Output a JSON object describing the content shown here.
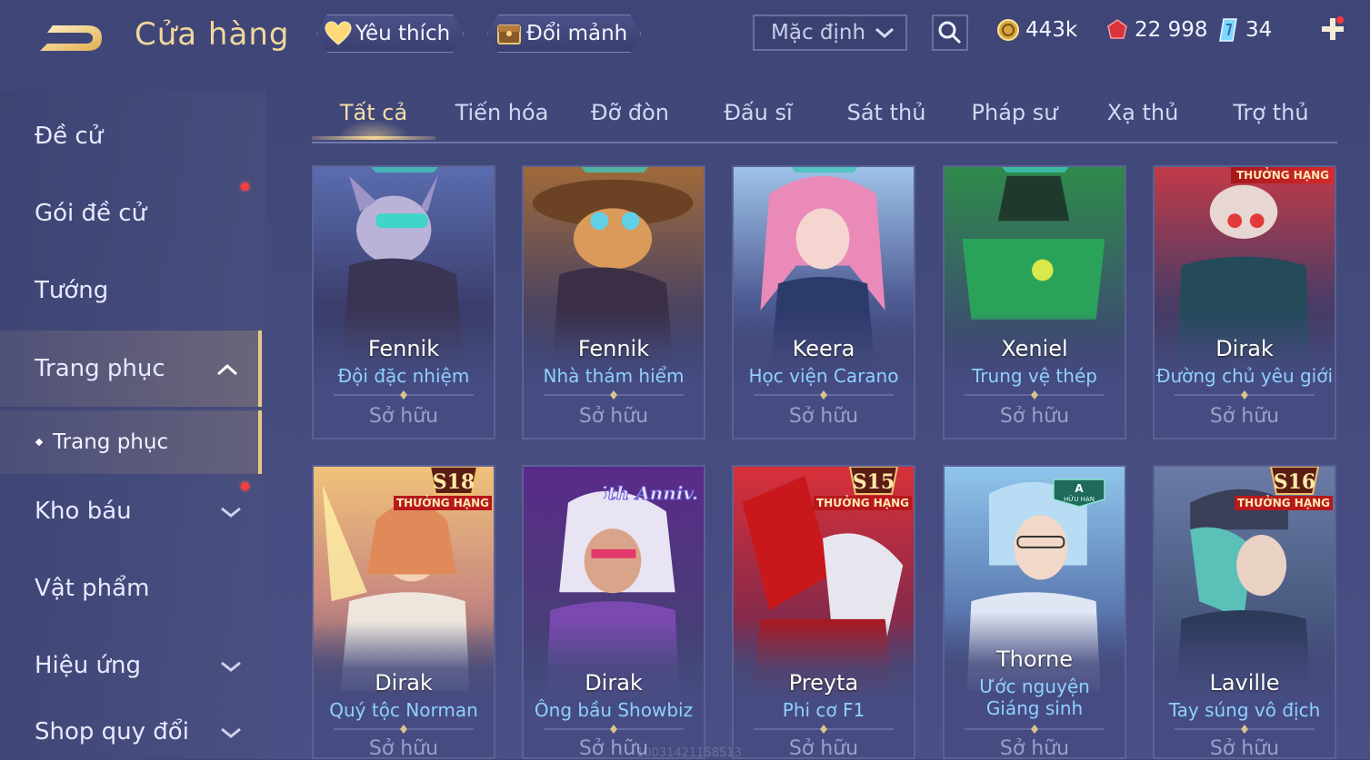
{
  "header": {
    "title": "Cửa hàng",
    "favorite_label": "Yêu thích",
    "exchange_label": "Đổi mảnh",
    "sort_value": "Mặc định",
    "currencies": {
      "gold": "443k",
      "ruby": "22 998",
      "voucher": "34"
    }
  },
  "sidebar": {
    "items": [
      {
        "label": "Đề cử"
      },
      {
        "label": "Gói đề cử"
      },
      {
        "label": "Tướng"
      },
      {
        "label": "Trang phục"
      },
      {
        "label": "Kho báu"
      },
      {
        "label": "Vật phẩm"
      },
      {
        "label": "Hiệu ứng"
      },
      {
        "label": "Shop quy đổi"
      }
    ],
    "subitem": "Trang phục"
  },
  "tabs": [
    "Tất cả",
    "Tiến hóa",
    "Đỡ đòn",
    "Đấu sĩ",
    "Sát thủ",
    "Pháp sư",
    "Xạ thủ",
    "Trợ thủ"
  ],
  "cards": [
    {
      "hero": "Fennik",
      "skin": "Đội đặc nhiệm",
      "status": "Sở hữu",
      "badge": ""
    },
    {
      "hero": "Fennik",
      "skin": "Nhà thám hiểm",
      "status": "Sở hữu",
      "badge": ""
    },
    {
      "hero": "Keera",
      "skin": "Học viện Carano",
      "status": "Sở hữu",
      "badge": ""
    },
    {
      "hero": "Xeniel",
      "skin": "Trung vệ thép",
      "status": "Sở hữu",
      "badge": ""
    },
    {
      "hero": "Dirak",
      "skin": "Đường chủ yêu giới",
      "status": "Sở hữu",
      "badge": "THƯỞNG HẠNG"
    },
    {
      "hero": "Dirak",
      "skin": "Quý tộc Norman",
      "status": "Sở hữu",
      "badge": "THƯỞNG HẠNG",
      "season": "S18"
    },
    {
      "hero": "Dirak",
      "skin": "Ông bầu Showbiz",
      "status": "Sở hữu",
      "badge": "5th Anniv."
    },
    {
      "hero": "Preyta",
      "skin": "Phi cơ F1",
      "status": "Sở hữu",
      "badge": "THƯỞNG HẠNG",
      "season": "S15"
    },
    {
      "hero": "Thorne",
      "skin": "Ước nguyện Giáng sinh",
      "status": "Sở hữu",
      "badge": "HỮU HẠN",
      "tier": "A"
    },
    {
      "hero": "Laville",
      "skin": "Tay súng vô địch",
      "status": "Sở hữu",
      "badge": "THƯỞNG HẠNG",
      "season": "S16"
    }
  ],
  "colors": {
    "accent_gold": "#f1d79c",
    "skin_blue": "#8fd0ff",
    "notify_red": "#ff3b3b"
  },
  "watermark": "10031421158513"
}
